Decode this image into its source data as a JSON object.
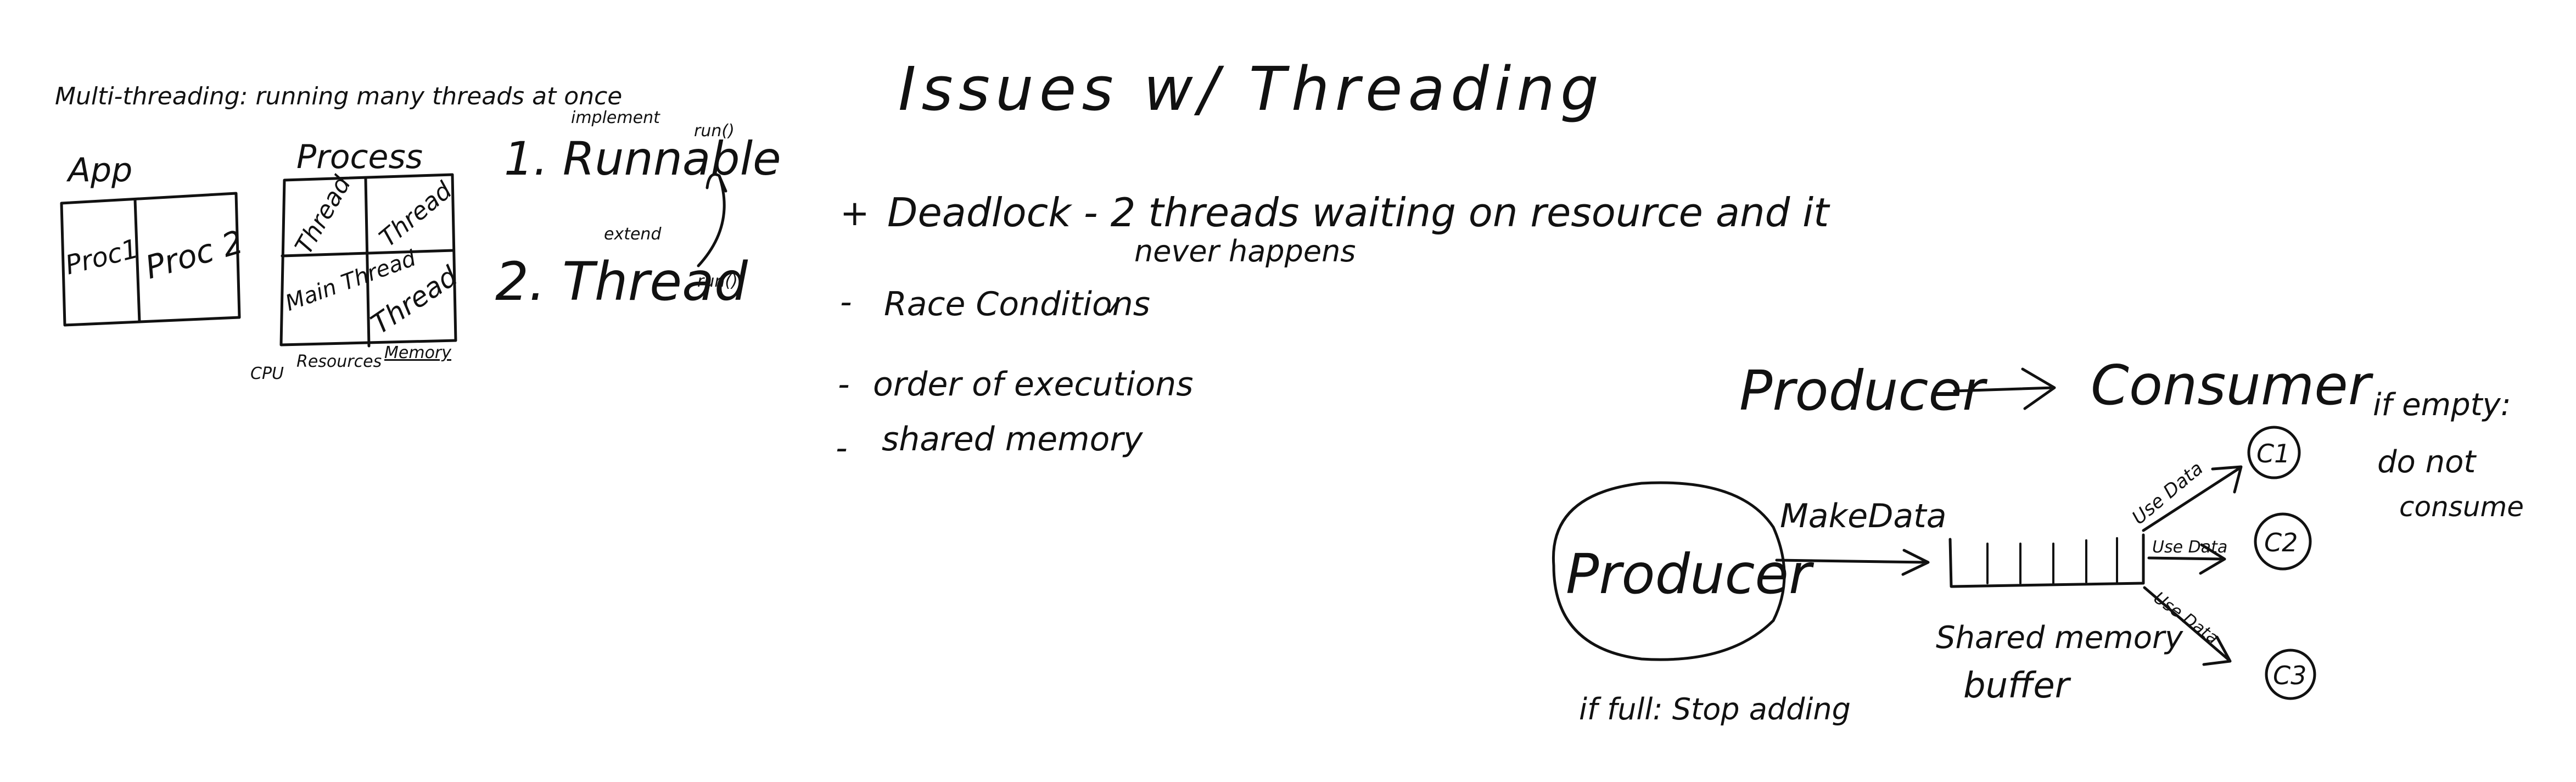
{
  "ink_color": "#111111",
  "background": "#ffffff",
  "left": {
    "heading": "Multi-threading: running many threads at once",
    "app_label": "App",
    "app_cells": [
      "Proc1",
      "Proc 2"
    ],
    "process_label": "Process",
    "process_cells": [
      "Thread",
      "Thread",
      "Main Thread",
      "Thread"
    ],
    "process_footer": [
      "CPU",
      "Resources",
      "Memory"
    ],
    "ways": [
      {
        "label": "1. Runnable",
        "note": "implement",
        "method": "run()"
      },
      {
        "label": "2. Thread",
        "note": "extend",
        "method": "run()"
      }
    ]
  },
  "issues": {
    "title": "Issues w/ Threading",
    "items": [
      {
        "bullet": "+",
        "text": "Deadlock - 2 threads waiting on resource and it",
        "continuation": "never happens"
      },
      {
        "bullet": "-",
        "text": "Race Conditions",
        "mark": "✓"
      },
      {
        "bullet": "-",
        "text": "order of executions"
      },
      {
        "bullet": "-",
        "text": "shared memory"
      }
    ]
  },
  "producer_consumer": {
    "header_left": "Producer",
    "header_right": "Consumer",
    "if_empty": [
      "if empty:",
      "do not",
      "consume"
    ],
    "producer_label": "Producer",
    "make_data": "MakeData",
    "buffer_label": [
      "Shared memory",
      "buffer"
    ],
    "use_data": [
      "Use Data",
      "Use Data",
      "Use Data"
    ],
    "consumers": [
      "C1",
      "C2",
      "C3"
    ],
    "if_full": "if full: Stop adding"
  }
}
